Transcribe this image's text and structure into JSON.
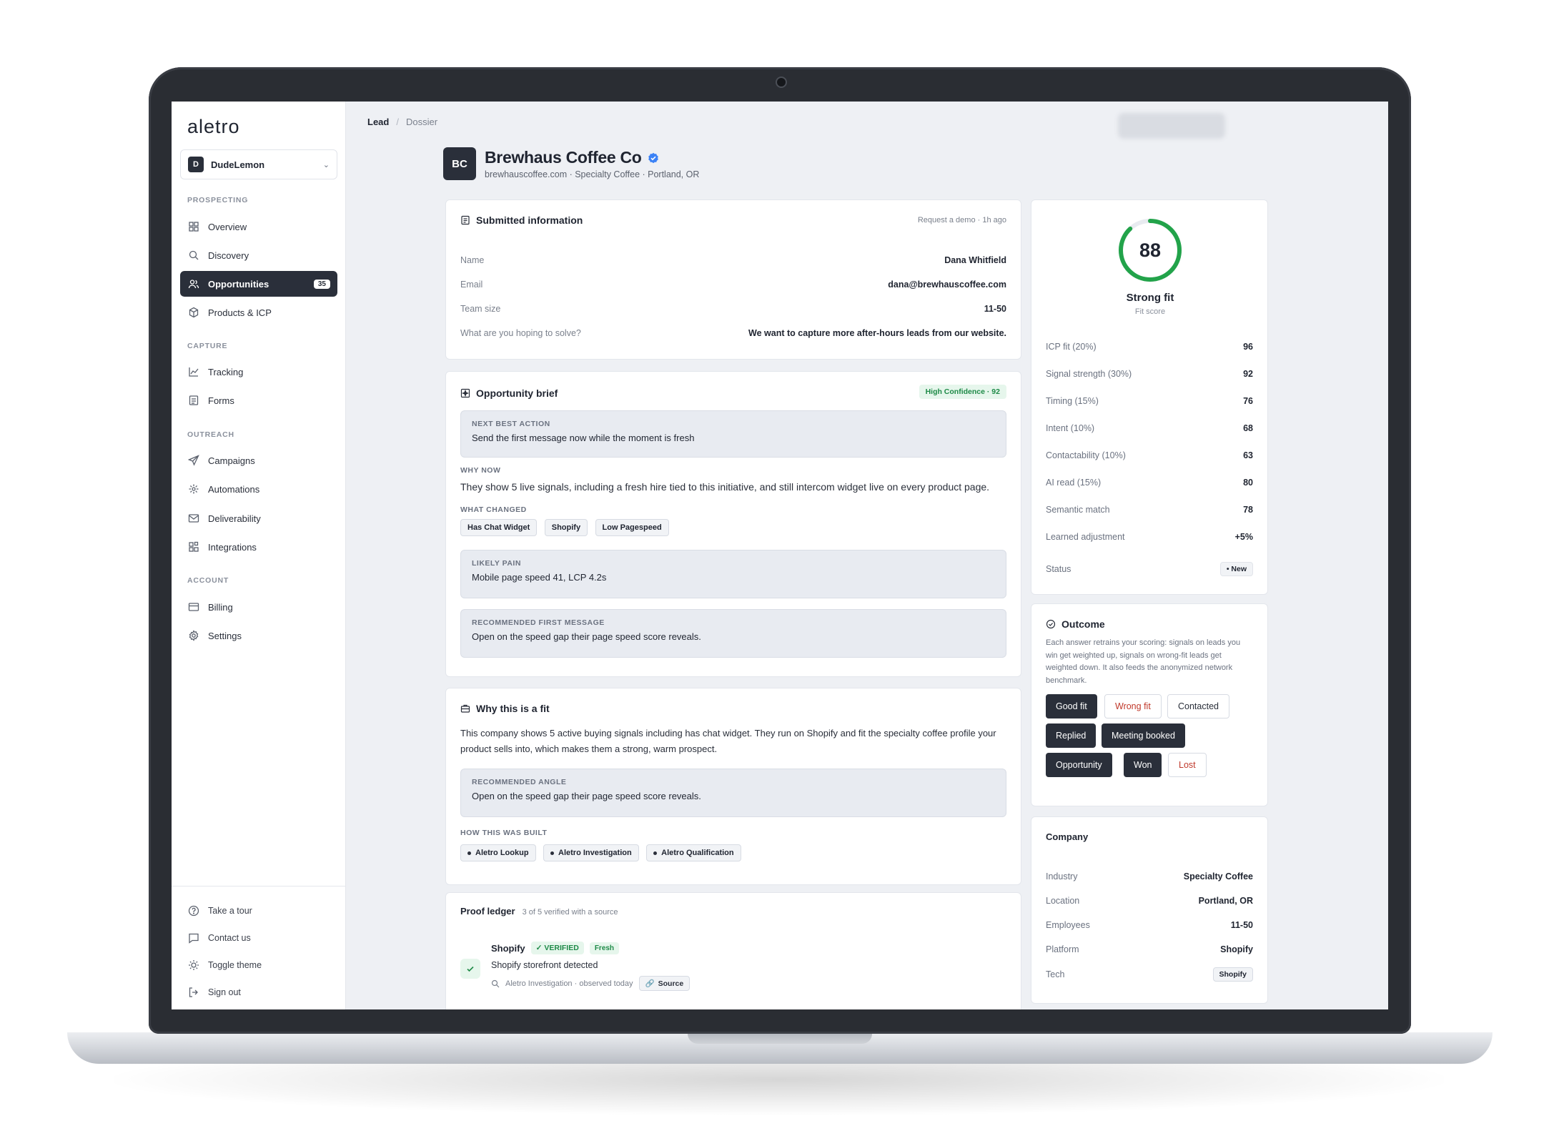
{
  "app": {
    "logo": "aletro"
  },
  "workspace": {
    "initial": "D",
    "name": "DudeLemon"
  },
  "nav": {
    "sections": {
      "prospecting": "PROSPECTING",
      "capture": "CAPTURE",
      "outreach": "OUTREACH",
      "account": "ACCOUNT"
    },
    "items": {
      "overview": "Overview",
      "discovery": "Discovery",
      "opportunities": "Opportunities",
      "opportunities_count": "35",
      "products": "Products & ICP",
      "tracking": "Tracking",
      "forms": "Forms",
      "campaigns": "Campaigns",
      "automations": "Automations",
      "deliverability": "Deliverability",
      "integrations": "Integrations",
      "billing": "Billing",
      "settings": "Settings"
    },
    "footer": {
      "tour": "Take a tour",
      "contact": "Contact us",
      "theme": "Toggle theme",
      "signout": "Sign out"
    }
  },
  "breadcrumb": {
    "lead": "Lead",
    "sep": "/",
    "dossier": "Dossier"
  },
  "company": {
    "initials": "BC",
    "name": "Brewhaus Coffee Co",
    "subtitle": "brewhauscoffee.com · Specialty Coffee · Portland, OR"
  },
  "submitted": {
    "title": "Submitted information",
    "meta": "Request a demo · 1h ago",
    "rows": [
      {
        "k": "Name",
        "v": "Dana Whitfield"
      },
      {
        "k": "Email",
        "v": "dana@brewhauscoffee.com"
      },
      {
        "k": "Team size",
        "v": "11-50"
      },
      {
        "k": "What are you hoping to solve?",
        "v": "We want to capture more after-hours leads from our website."
      }
    ]
  },
  "brief": {
    "title": "Opportunity brief",
    "confidence": "High Confidence · 92",
    "next_label": "NEXT BEST ACTION",
    "next_text": "Send the first message now while the moment is fresh",
    "why_label": "WHY NOW",
    "why_text": "They show 5 live signals, including a fresh hire tied to this initiative, and still intercom widget live on every product page.",
    "changed_label": "WHAT CHANGED",
    "changed_tags": [
      "Has Chat Widget",
      "Shopify",
      "Low Pagespeed"
    ],
    "pain_label": "LIKELY PAIN",
    "pain_text": "Mobile page speed 41, LCP 4.2s",
    "msg_label": "RECOMMENDED FIRST MESSAGE",
    "msg_text": "Open on the speed gap their page speed score reveals."
  },
  "fit": {
    "title": "Why this is a fit",
    "text": "This company shows 5 active buying signals including has chat widget. They run on Shopify and fit the specialty coffee profile your product sells into, which makes them a strong, warm prospect.",
    "angle_label": "RECOMMENDED ANGLE",
    "angle_text": "Open on the speed gap their page speed score reveals.",
    "built_label": "HOW THIS WAS BUILT",
    "built_tags": [
      "Aletro Lookup",
      "Aletro Investigation",
      "Aletro Qualification"
    ]
  },
  "proof": {
    "title": "Proof ledger",
    "meta": "3 of 5 verified with a source",
    "item_name": "Shopify",
    "item_verified": "✓ VERIFIED",
    "item_fresh": "Fresh",
    "item_text": "Shopify storefront detected",
    "item_source_meta": "Aletro Investigation · observed today",
    "item_source_btn": "Source"
  },
  "score": {
    "value": "88",
    "percent": 88,
    "label": "Strong fit",
    "sub": "Fit score",
    "metrics": [
      {
        "k": "ICP fit (20%)",
        "v": "96"
      },
      {
        "k": "Signal strength (30%)",
        "v": "92"
      },
      {
        "k": "Timing (15%)",
        "v": "76"
      },
      {
        "k": "Intent (10%)",
        "v": "68"
      },
      {
        "k": "Contactability (10%)",
        "v": "63"
      },
      {
        "k": "AI read (15%)",
        "v": "80"
      },
      {
        "k": "Semantic match",
        "v": "78"
      },
      {
        "k": "Learned adjustment",
        "v": "+5%"
      }
    ],
    "status_label": "Status",
    "status_value": "• New",
    "ring_color": "#22a34a"
  },
  "outcome": {
    "title": "Outcome",
    "desc": "Each answer retrains your scoring: signals on leads you win get weighted up, signals on wrong-fit leads get weighted down. It also feeds the anonymized network benchmark.",
    "buttons": {
      "good": "Good fit",
      "wrong": "Wrong fit",
      "contacted": "Contacted",
      "replied": "Replied",
      "meeting": "Meeting booked",
      "opportunity": "Opportunity",
      "won": "Won",
      "lost": "Lost"
    }
  },
  "company_card": {
    "title": "Company",
    "rows": [
      {
        "k": "Industry",
        "v": "Specialty Coffee"
      },
      {
        "k": "Location",
        "v": "Portland, OR"
      },
      {
        "k": "Employees",
        "v": "11-50"
      },
      {
        "k": "Platform",
        "v": "Shopify"
      }
    ],
    "tech_label": "Tech",
    "tech_value": "Shopify"
  }
}
